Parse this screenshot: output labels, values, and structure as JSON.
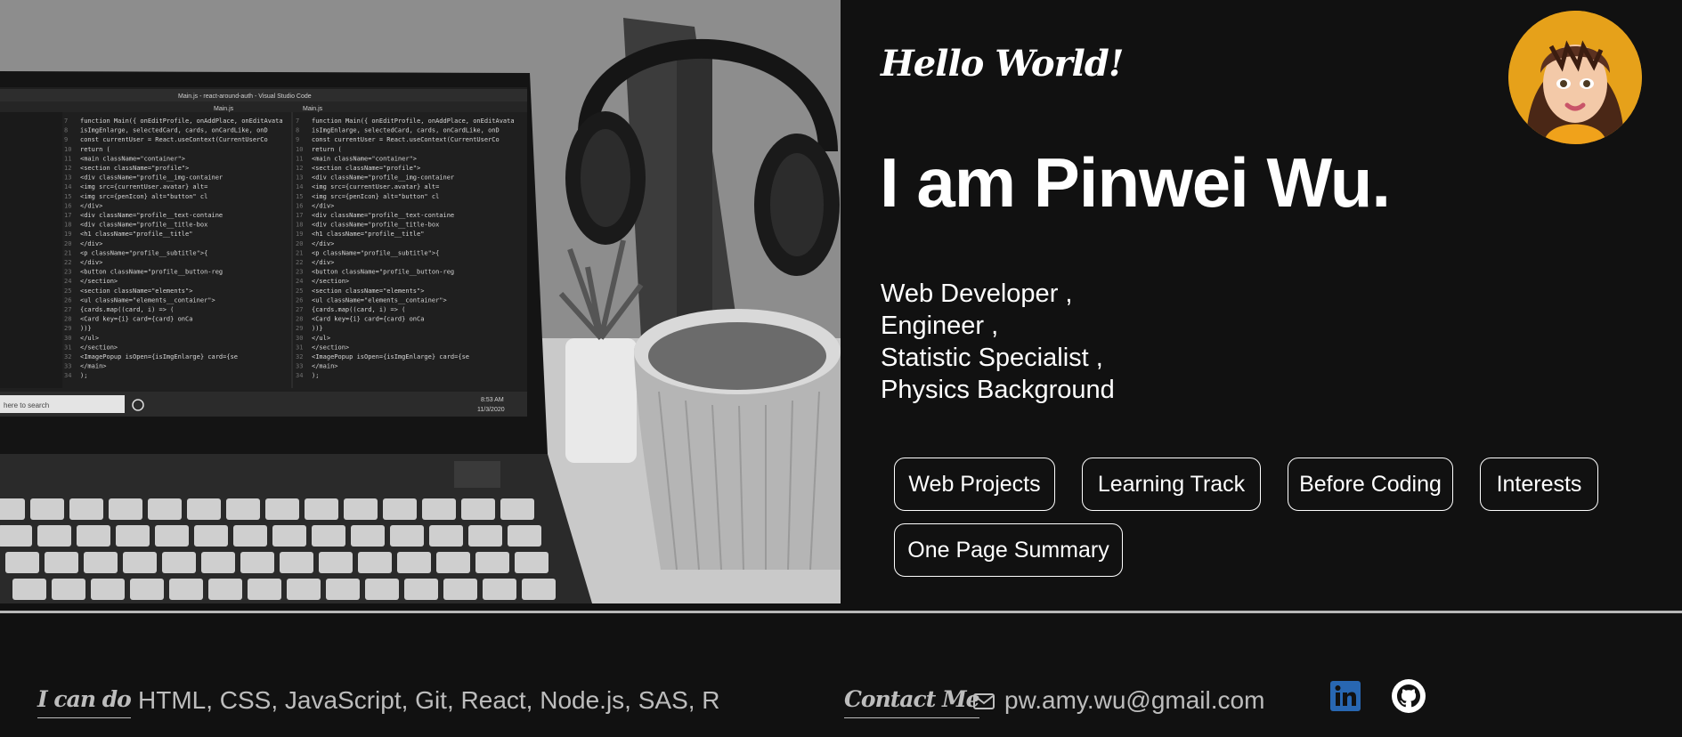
{
  "intro": {
    "greeting": "Hello World!",
    "name": "I am Pinwei Wu.",
    "roles": [
      "Web Developer ,",
      "Engineer ,",
      "Statistic Specialist ,",
      "Physics Background"
    ]
  },
  "nav": {
    "items": [
      {
        "label": "Web Projects"
      },
      {
        "label": "Learning Track"
      },
      {
        "label": "Before Coding"
      },
      {
        "label": "Interests"
      },
      {
        "label": "One Page Summary"
      }
    ]
  },
  "footer": {
    "skills_label": "I can do",
    "skills": "HTML, CSS, JavaScript, Git, React, Node.js, SAS, R",
    "contact_label": "Contact Me",
    "email": "pw.amy.wu@gmail.com",
    "icons": [
      "mail-icon",
      "linkedin-icon",
      "github-icon"
    ]
  },
  "photo": {
    "editor_title": "Main.js - react-around-auth - Visual Studio Code",
    "tabs": [
      "Main.js",
      "Main.js"
    ],
    "code_lines": [
      "function Main({ onEditProfile, onAddPlace, onEditAvata",
      "  isImgEnlarge, selectedCard, cards, onCardLike, onD",
      "  const currentUser = React.useContext(CurrentUserCo",
      "  return (",
      "    <main className=\"container\">",
      "      <section className=\"profile\">",
      "        <div className=\"profile__img-container",
      "          <img src={currentUser.avatar} alt=",
      "          <img src={penIcon} alt=\"button\" cl",
      "        </div>",
      "        <div className=\"profile__text-containe",
      "          <div className=\"profile__title-box",
      "            <h1 className=\"profile__title\"",
      "          </div>",
      "          <p className=\"profile__subtitle\">{",
      "        </div>",
      "        <button className=\"profile__button-reg",
      "      </section>",
      "      <section className=\"elements\">",
      "        <ul className=\"elements__container\">",
      "          {cards.map((card, i) => (",
      "            <Card key={i} card={card} onCa",
      "          ))}",
      "        </ul>",
      "      </section>",
      "      <ImagePopup isOpen={isImgEnlarge} card={se",
      "    </main>",
      "  );"
    ],
    "taskbar_search": "here to search",
    "clock_time": "8:53 AM",
    "clock_date": "11/3/2020"
  },
  "colors": {
    "background": "#111111",
    "text": "#ffffff",
    "muted_text": "#bdbdbd",
    "avatar_bg": "#e6a11a",
    "linkedin": "#2867b2"
  }
}
